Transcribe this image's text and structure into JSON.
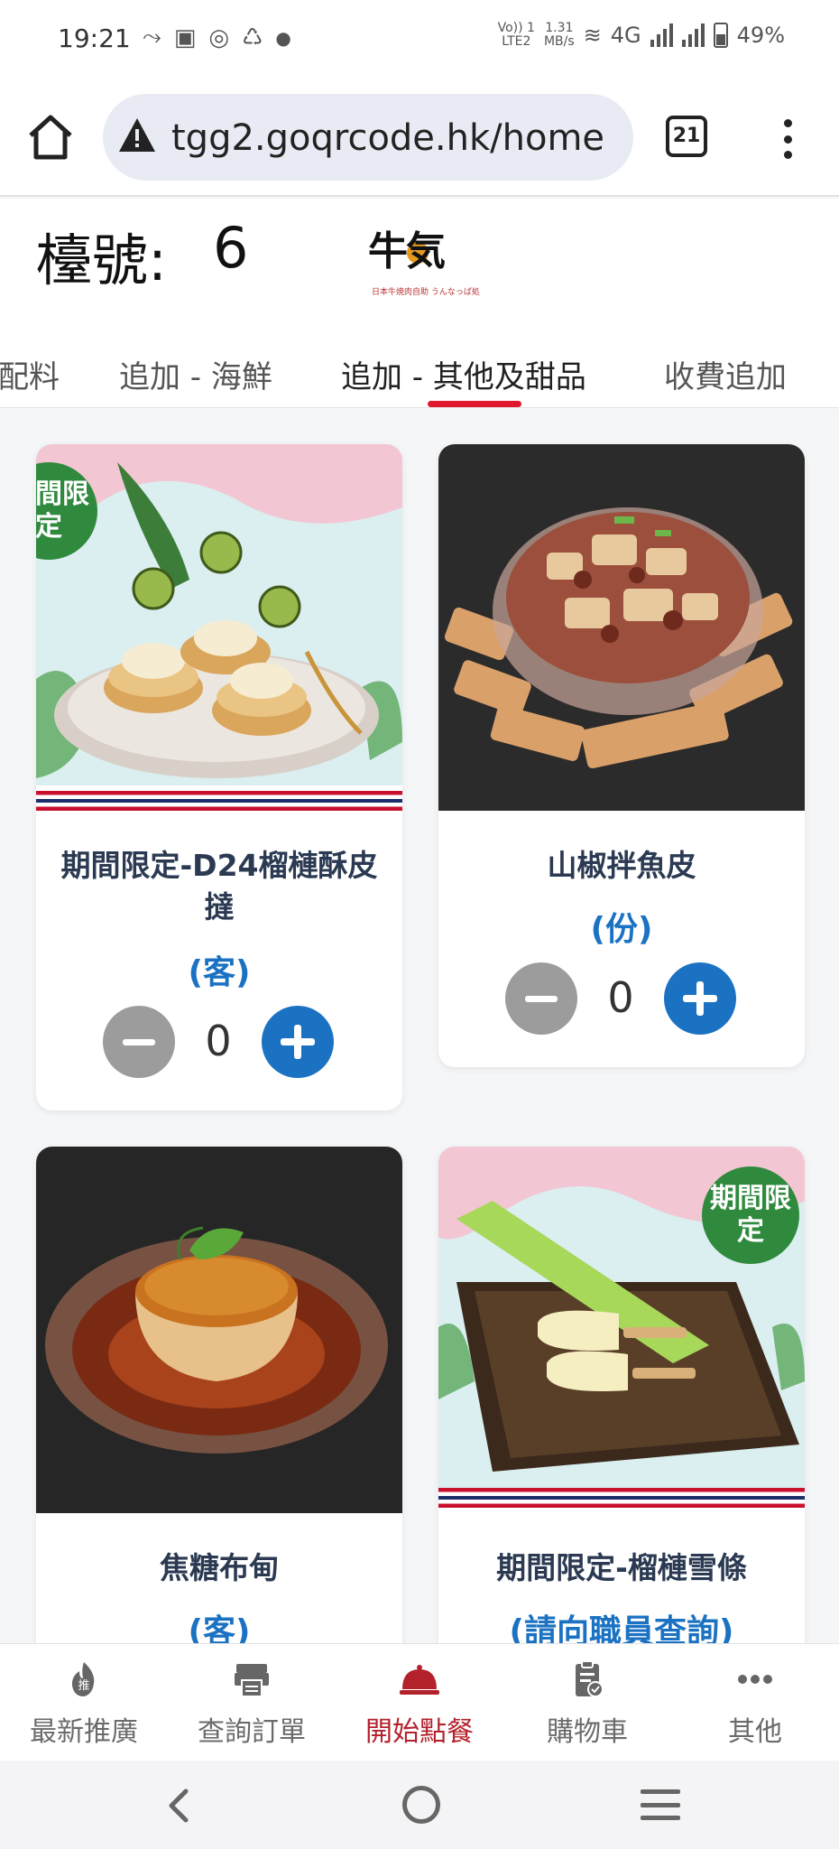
{
  "status_bar": {
    "time": "19:21",
    "network_type": "4G",
    "speed_value": "1.31",
    "speed_unit": "MB/s",
    "volte_line1": "Vo)) 1",
    "volte_line2": "LTE2",
    "battery": "49%",
    "notification_icons": [
      "missed-call-icon",
      "app-notification-icon",
      "instagram-icon",
      "sync-icon",
      "dot-icon"
    ]
  },
  "browser": {
    "url": "tgg2.goqrcode.hk/home",
    "tab_count": "21"
  },
  "header": {
    "table_label": "檯號:",
    "table_number": "6",
    "logo_text": "牛気",
    "logo_subtext": "日本牛焼肉自助 うんなっぱ処"
  },
  "category_tabs": [
    {
      "label": "配料",
      "active": false
    },
    {
      "label": "追加 - 海鮮",
      "active": false
    },
    {
      "label": "追加 - 其他及甜品",
      "active": true
    },
    {
      "label": "收費追加",
      "active": false
    }
  ],
  "menu_items": [
    {
      "name": "期間限定-D24榴槤酥皮撻",
      "unit": "(客)",
      "quantity": "0",
      "limited_badge": "期間限定"
    },
    {
      "name": "山椒拌魚皮",
      "unit": "(份)",
      "quantity": "0"
    },
    {
      "name": "焦糖布甸",
      "unit": "(客)"
    },
    {
      "name": "期間限定-榴槤雪條",
      "unit": "(請向職員查詢)",
      "limited_badge": "期間限定"
    }
  ],
  "bottom_nav": [
    {
      "label": "最新推廣",
      "icon": "promo-fire-icon"
    },
    {
      "label": "查詢訂單",
      "icon": "printer-icon"
    },
    {
      "label": "開始點餐",
      "icon": "cloche-icon",
      "active": true
    },
    {
      "label": "購物車",
      "icon": "clipboard-check-icon"
    },
    {
      "label": "其他",
      "icon": "more-dots-icon"
    }
  ],
  "colors": {
    "accent_red": "#e0182d",
    "primary_blue": "#1b72c2",
    "active_nav": "#b3212b",
    "limited_green": "#2f8a3e"
  }
}
